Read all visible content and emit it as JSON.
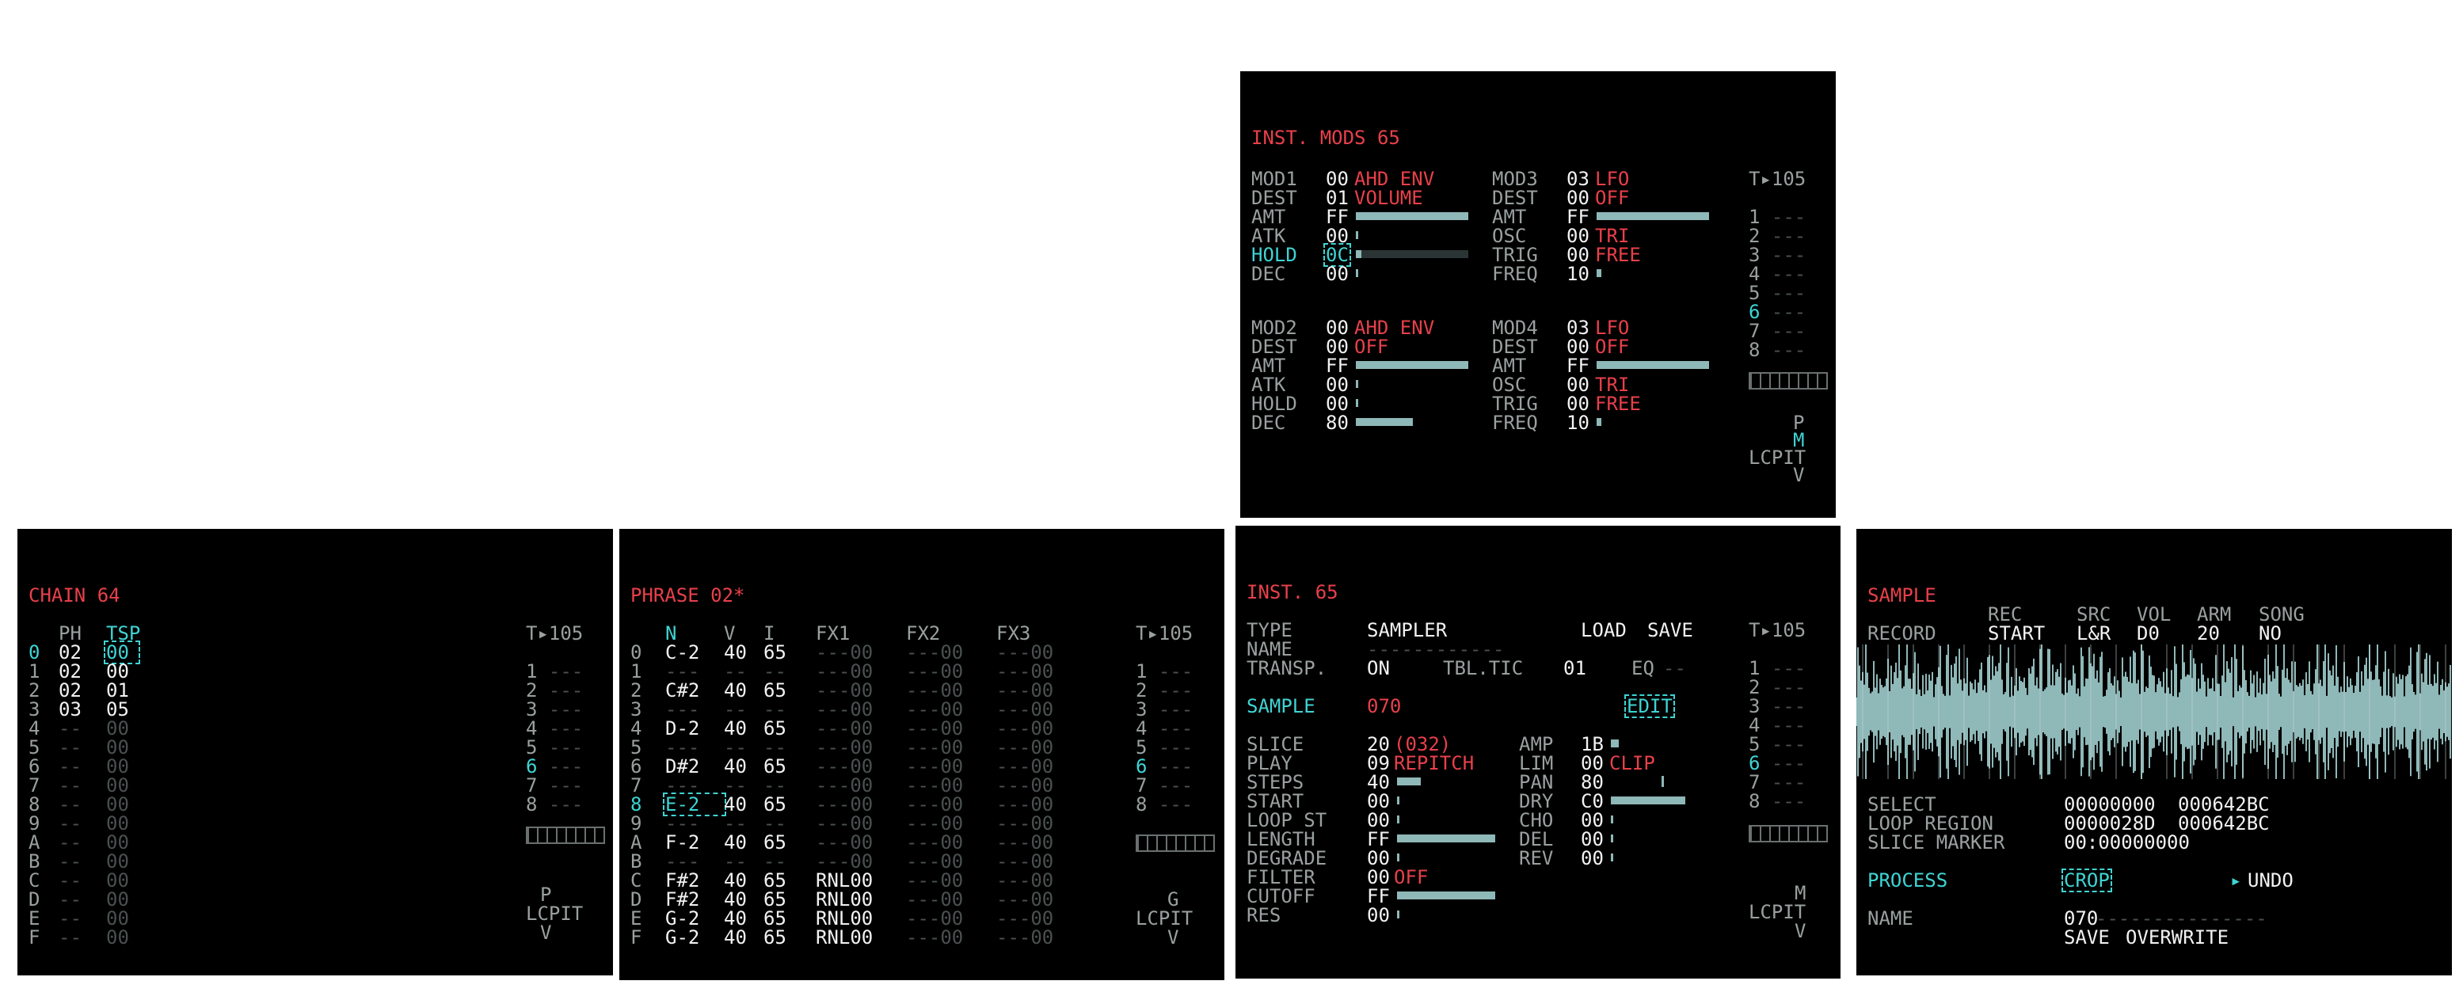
{
  "inst_mods": {
    "title": "INST. MODS 65",
    "tempo": "T▸105",
    "mod1": {
      "label": "MOD1",
      "val": "00",
      "type": "AHD ENV",
      "dest_l": "DEST",
      "dest_v": "01",
      "dest": "VOLUME",
      "amt_l": "AMT",
      "amt_v": "FF",
      "amt_fill": 1.0,
      "atk_l": "ATK",
      "atk_v": "00",
      "hold_l": "HOLD",
      "hold_v": "0C",
      "hold_fill": 0.05,
      "dec_l": "DEC",
      "dec_v": "00"
    },
    "mod3": {
      "label": "MOD3",
      "val": "03",
      "type": "LFO",
      "dest_l": "DEST",
      "dest_v": "00",
      "dest": "OFF",
      "amt_l": "AMT",
      "amt_v": "FF",
      "amt_fill": 1.0,
      "osc_l": "OSC",
      "osc_v": "00",
      "osc": "TRI",
      "trig_l": "TRIG",
      "trig_v": "00",
      "trig": "FREE",
      "freq_l": "FREQ",
      "freq_v": "10"
    },
    "mod2": {
      "label": "MOD2",
      "val": "00",
      "type": "AHD ENV",
      "dest_l": "DEST",
      "dest_v": "00",
      "dest": "OFF",
      "amt_l": "AMT",
      "amt_v": "FF",
      "amt_fill": 1.0,
      "atk_l": "ATK",
      "atk_v": "00",
      "hold_l": "HOLD",
      "hold_v": "00",
      "dec_l": "DEC",
      "dec_v": "80",
      "dec_fill": 0.5
    },
    "mod4": {
      "label": "MOD4",
      "val": "03",
      "type": "LFO",
      "dest_l": "DEST",
      "dest_v": "00",
      "dest": "OFF",
      "amt_l": "AMT",
      "amt_v": "FF",
      "amt_fill": 1.0,
      "osc_l": "OSC",
      "osc_v": "00",
      "osc": "TRI",
      "trig_l": "TRIG",
      "trig_v": "00",
      "trig": "FREE",
      "freq_l": "FREQ",
      "freq_v": "10"
    },
    "tracks": [
      "1",
      "2",
      "3",
      "4",
      "5",
      "6",
      "7",
      "8"
    ],
    "active_track": "6",
    "nav": {
      "top": "P",
      "mid": "M",
      "row": "LCPIT",
      "bottom": "V"
    }
  },
  "chain": {
    "title": "CHAIN 64",
    "tempo": "T▸105",
    "col_ph": "PH",
    "col_tsp": "TSP",
    "rows": [
      {
        "i": "0",
        "ph": "02",
        "tsp": "00"
      },
      {
        "i": "1",
        "ph": "02",
        "tsp": "00"
      },
      {
        "i": "2",
        "ph": "02",
        "tsp": "01"
      },
      {
        "i": "3",
        "ph": "03",
        "tsp": "05"
      },
      {
        "i": "4",
        "ph": "--",
        "tsp": "00"
      },
      {
        "i": "5",
        "ph": "--",
        "tsp": "00"
      },
      {
        "i": "6",
        "ph": "--",
        "tsp": "00"
      },
      {
        "i": "7",
        "ph": "--",
        "tsp": "00"
      },
      {
        "i": "8",
        "ph": "--",
        "tsp": "00"
      },
      {
        "i": "9",
        "ph": "--",
        "tsp": "00"
      },
      {
        "i": "A",
        "ph": "--",
        "tsp": "00"
      },
      {
        "i": "B",
        "ph": "--",
        "tsp": "00"
      },
      {
        "i": "C",
        "ph": "--",
        "tsp": "00"
      },
      {
        "i": "D",
        "ph": "--",
        "tsp": "00"
      },
      {
        "i": "E",
        "ph": "--",
        "tsp": "00"
      },
      {
        "i": "F",
        "ph": "--",
        "tsp": "00"
      }
    ],
    "tracks": [
      "1",
      "2",
      "3",
      "4",
      "5",
      "6",
      "7",
      "8"
    ],
    "active_track": "6",
    "nav": {
      "top": "P",
      "row": "LCPIT",
      "bottom": "V"
    }
  },
  "phrase": {
    "title": "PHRASE 02*",
    "tempo": "T▸105",
    "cols": {
      "n": "N",
      "v": "V",
      "i": "I",
      "fx1": "FX1",
      "fx2": "FX2",
      "fx3": "FX3"
    },
    "rows": [
      {
        "i": "0",
        "n": "C-2",
        "v": "40",
        "ins": "65",
        "fx1": "---00",
        "fx2": "---00",
        "fx3": "---00"
      },
      {
        "i": "1",
        "n": "---",
        "v": "--",
        "ins": "--",
        "fx1": "---00",
        "fx2": "---00",
        "fx3": "---00"
      },
      {
        "i": "2",
        "n": "C#2",
        "v": "40",
        "ins": "65",
        "fx1": "---00",
        "fx2": "---00",
        "fx3": "---00"
      },
      {
        "i": "3",
        "n": "---",
        "v": "--",
        "ins": "--",
        "fx1": "---00",
        "fx2": "---00",
        "fx3": "---00"
      },
      {
        "i": "4",
        "n": "D-2",
        "v": "40",
        "ins": "65",
        "fx1": "---00",
        "fx2": "---00",
        "fx3": "---00"
      },
      {
        "i": "5",
        "n": "---",
        "v": "--",
        "ins": "--",
        "fx1": "---00",
        "fx2": "---00",
        "fx3": "---00"
      },
      {
        "i": "6",
        "n": "D#2",
        "v": "40",
        "ins": "65",
        "fx1": "---00",
        "fx2": "---00",
        "fx3": "---00"
      },
      {
        "i": "7",
        "n": "---",
        "v": "--",
        "ins": "--",
        "fx1": "---00",
        "fx2": "---00",
        "fx3": "---00"
      },
      {
        "i": "8",
        "n": "E-2",
        "v": "40",
        "ins": "65",
        "fx1": "---00",
        "fx2": "---00",
        "fx3": "---00"
      },
      {
        "i": "9",
        "n": "---",
        "v": "--",
        "ins": "--",
        "fx1": "---00",
        "fx2": "---00",
        "fx3": "---00"
      },
      {
        "i": "A",
        "n": "F-2",
        "v": "40",
        "ins": "65",
        "fx1": "---00",
        "fx2": "---00",
        "fx3": "---00"
      },
      {
        "i": "B",
        "n": "---",
        "v": "--",
        "ins": "--",
        "fx1": "---00",
        "fx2": "---00",
        "fx3": "---00"
      },
      {
        "i": "C",
        "n": "F#2",
        "v": "40",
        "ins": "65",
        "fx1": "RNL00",
        "fx2": "---00",
        "fx3": "---00"
      },
      {
        "i": "D",
        "n": "F#2",
        "v": "40",
        "ins": "65",
        "fx1": "RNL00",
        "fx2": "---00",
        "fx3": "---00"
      },
      {
        "i": "E",
        "n": "G-2",
        "v": "40",
        "ins": "65",
        "fx1": "RNL00",
        "fx2": "---00",
        "fx3": "---00"
      },
      {
        "i": "F",
        "n": "G-2",
        "v": "40",
        "ins": "65",
        "fx1": "RNL00",
        "fx2": "---00",
        "fx3": "---00"
      }
    ],
    "tracks": [
      "1",
      "2",
      "3",
      "4",
      "5",
      "6",
      "7",
      "8"
    ],
    "active_track": "6",
    "nav": {
      "top": "G",
      "row": "LCPIT",
      "bottom": "V"
    }
  },
  "inst": {
    "title": "INST. 65",
    "tempo": "T▸105",
    "type_l": "TYPE",
    "type_v": "SAMPLER",
    "load": "LOAD",
    "save": "SAVE",
    "name_l": "NAME",
    "name_v": "------------",
    "transp_l": "TRANSP.",
    "transp_v": "ON",
    "tbltic_l": "TBL.TIC",
    "tbltic_v": "01",
    "eq_l": "EQ",
    "eq_v": "--",
    "sample_l": "SAMPLE",
    "sample_v": "070",
    "edit": "EDIT",
    "slice_l": "SLICE",
    "slice_v": "20",
    "slice_x": "(032)",
    "play_l": "PLAY",
    "play_v": "09",
    "play_x": "REPITCH",
    "steps_l": "STEPS",
    "steps_v": "40",
    "steps_fill": 0.25,
    "start_l": "START",
    "start_v": "00",
    "loopst_l": "LOOP ST",
    "loopst_v": "00",
    "length_l": "LENGTH",
    "length_v": "FF",
    "length_fill": 1.0,
    "degrade_l": "DEGRADE",
    "degrade_v": "00",
    "filter_l": "FILTER",
    "filter_v": "00",
    "filter_x": "OFF",
    "cutoff_l": "CUTOFF",
    "cutoff_v": "FF",
    "cutoff_fill": 1.0,
    "res_l": "RES",
    "res_v": "00",
    "amp_l": "AMP",
    "amp_v": "1B",
    "lim_l": "LIM",
    "lim_v": "00",
    "lim_x": "CLIP",
    "pan_l": "PAN",
    "pan_v": "80",
    "dry_l": "DRY",
    "dry_v": "C0",
    "dry_fill": 0.75,
    "cho_l": "CHO",
    "cho_v": "00",
    "del_l": "DEL",
    "del_v": "00",
    "rev_l": "REV",
    "rev_v": "00",
    "tracks": [
      "1",
      "2",
      "3",
      "4",
      "5",
      "6",
      "7",
      "8"
    ],
    "active_track": "6",
    "nav": {
      "top": "M",
      "row": "LCPIT",
      "bottom": "V"
    }
  },
  "sample": {
    "title": "SAMPLE",
    "record_l": "RECORD",
    "rec_h": "REC",
    "rec_v": "START",
    "src_h": "SRC",
    "src_v": "L&R",
    "vol_h": "VOL",
    "vol_v": "D0",
    "arm_h": "ARM",
    "arm_v": "20",
    "song_h": "SONG",
    "song_v": "NO",
    "select_l": "SELECT",
    "select_a": "00000000",
    "select_b": "000642BC",
    "loop_l": "LOOP REGION",
    "loop_a": "0000028D",
    "loop_b": "000642BC",
    "slice_l": "SLICE MARKER",
    "slice_v": "00:00000000",
    "process_l": "PROCESS",
    "crop": "CROP",
    "undo": "UNDO",
    "name_l": "NAME",
    "name_v": "070",
    "save": "SAVE",
    "overwrite": "OVERWRITE"
  },
  "colors": {
    "red": "#e8404a",
    "cyan": "#3fd4d4",
    "bar": "#8fb8b8",
    "bg": "#000000"
  }
}
